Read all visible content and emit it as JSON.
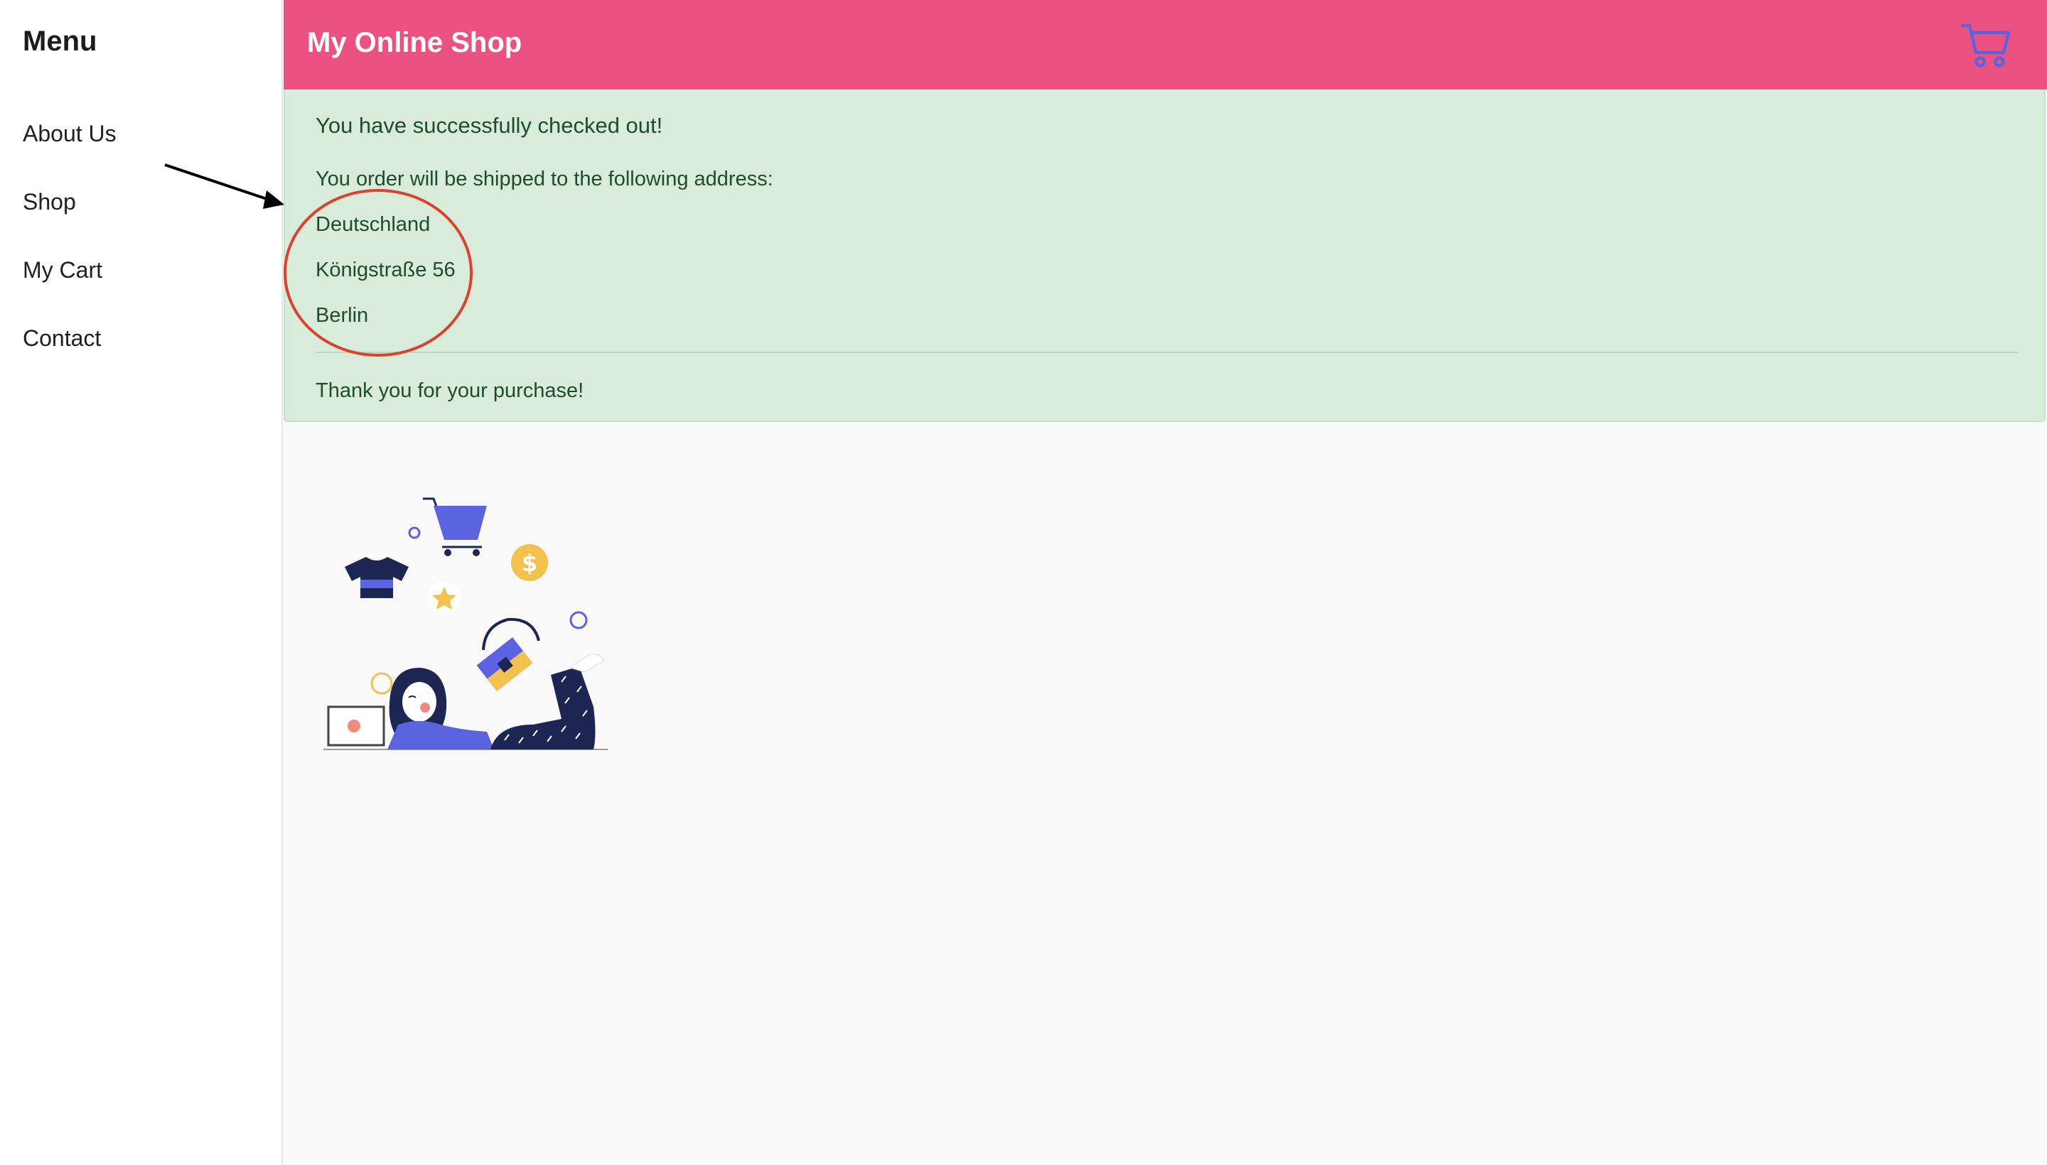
{
  "sidebar": {
    "title": "Menu",
    "items": [
      {
        "label": "About Us"
      },
      {
        "label": "Shop"
      },
      {
        "label": "My Cart"
      },
      {
        "label": "Contact"
      }
    ]
  },
  "header": {
    "title": "My Online Shop",
    "cart_icon": "shopping-cart-icon"
  },
  "alert": {
    "success_message": "You have successfully checked out!",
    "shipping_intro": "You order will be shipped to the following address:",
    "address": {
      "country": "Deutschland",
      "street": "Königstraße 56",
      "city": "Berlin"
    },
    "thanks": "Thank you for your purchase!"
  },
  "colors": {
    "header_bg": "#eb5282",
    "alert_bg": "#d9ebdb",
    "alert_text": "#1f4d2a",
    "annotation_circle": "#d9432b",
    "annotation_arrow": "#000000",
    "illustration_accent": "#5b63e0",
    "illustration_yellow": "#f2c14e",
    "illustration_navy": "#1d2552"
  },
  "illustration": {
    "icon": "online-shopping-woman-illustration"
  }
}
